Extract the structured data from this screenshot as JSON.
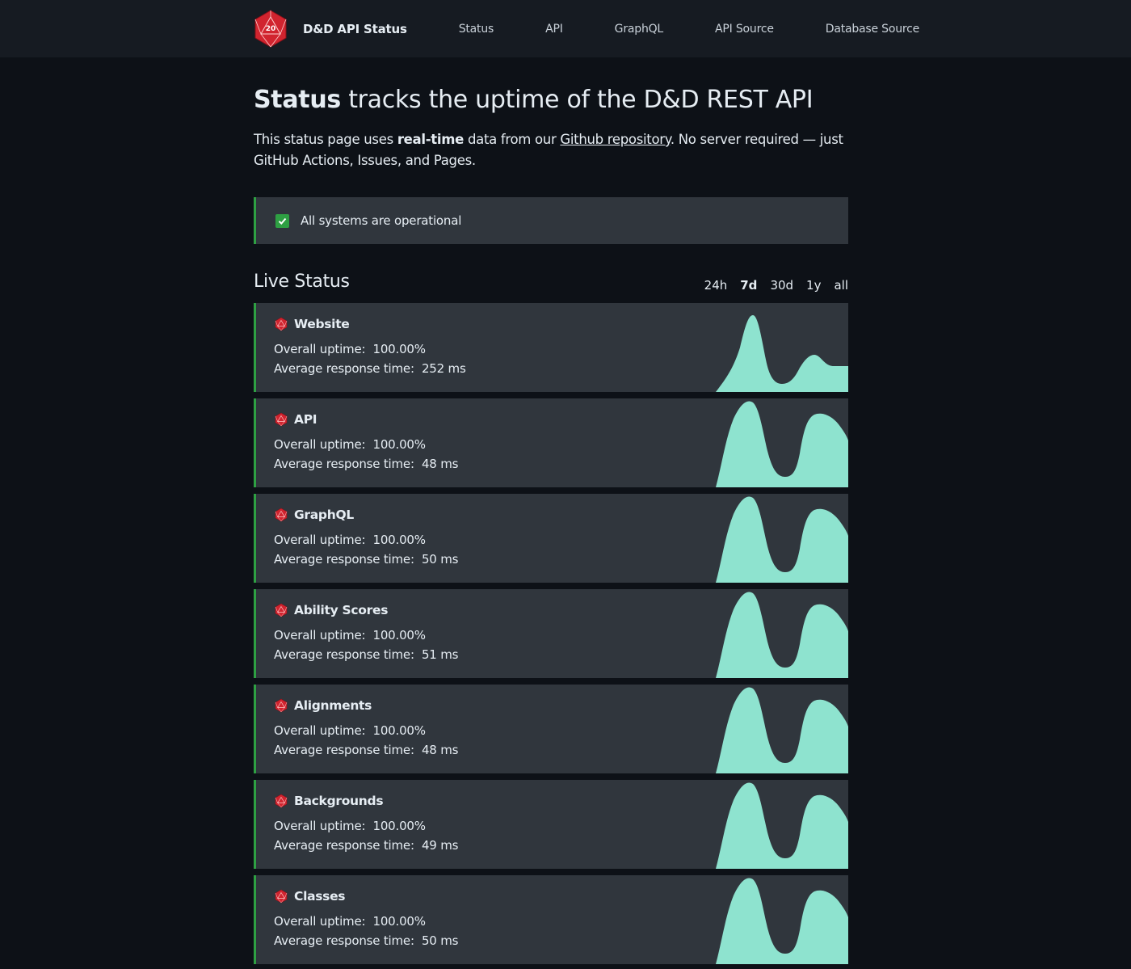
{
  "nav": {
    "brand": "D&D API Status",
    "logo_text": "20",
    "links": [
      "Status",
      "API",
      "GraphQL",
      "API Source",
      "Database Source"
    ]
  },
  "header": {
    "title_bold": "Status",
    "title_rest": " tracks the uptime of the D&D REST API",
    "intro_1": "This status page uses ",
    "intro_bold": "real-time",
    "intro_2": " data from our ",
    "intro_link": "Github repository",
    "intro_3": ". No server required — just GitHub Actions, Issues, and Pages."
  },
  "alert": {
    "text": "All systems are operational"
  },
  "live": {
    "title": "Live Status",
    "periods": [
      "24h",
      "7d",
      "30d",
      "1y",
      "all"
    ],
    "active_period": "7d"
  },
  "colors": {
    "accent_green": "#2ea043",
    "spark_fill": "#8ee3cf",
    "die_red": "#d1242f"
  },
  "services": [
    {
      "name": "Website",
      "uptime_label": "Overall uptime:  100.00%",
      "response_label": "Average response time:  252 ms",
      "spark": "website"
    },
    {
      "name": "API",
      "uptime_label": "Overall uptime:  100.00%",
      "response_label": "Average response time:  48 ms",
      "spark": "double"
    },
    {
      "name": "GraphQL",
      "uptime_label": "Overall uptime:  100.00%",
      "response_label": "Average response time:  50 ms",
      "spark": "double"
    },
    {
      "name": "Ability Scores",
      "uptime_label": "Overall uptime:  100.00%",
      "response_label": "Average response time:  51 ms",
      "spark": "double"
    },
    {
      "name": "Alignments",
      "uptime_label": "Overall uptime:  100.00%",
      "response_label": "Average response time:  48 ms",
      "spark": "double"
    },
    {
      "name": "Backgrounds",
      "uptime_label": "Overall uptime:  100.00%",
      "response_label": "Average response time:  49 ms",
      "spark": "double"
    },
    {
      "name": "Classes",
      "uptime_label": "Overall uptime:  100.00%",
      "response_label": "Average response time:  50 ms",
      "spark": "double"
    }
  ]
}
